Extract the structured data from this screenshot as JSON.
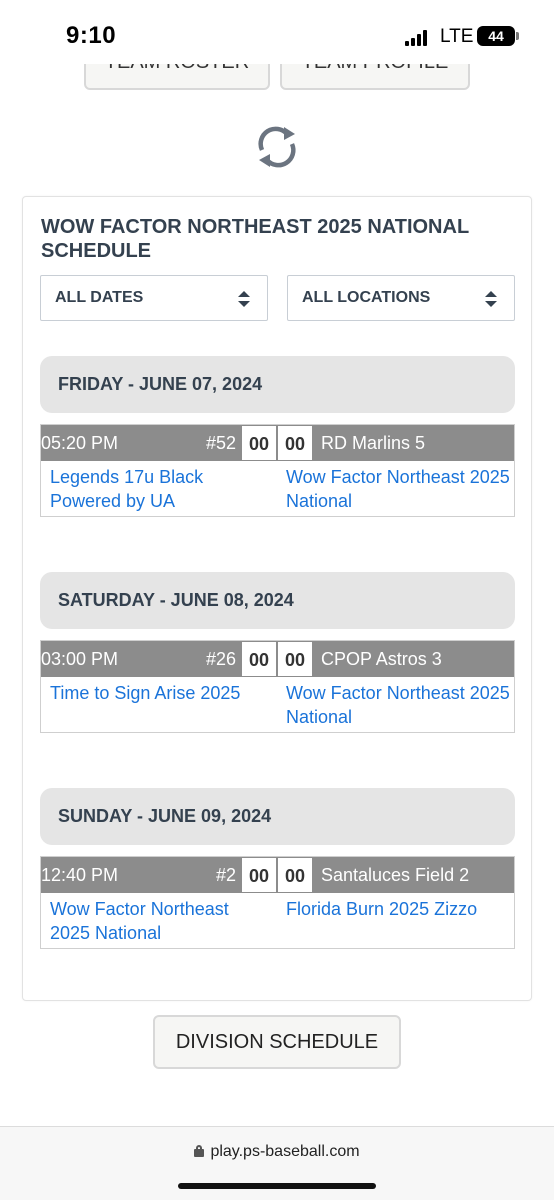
{
  "status": {
    "time": "9:10",
    "network": "LTE",
    "battery": "44"
  },
  "nav": {
    "roster_label": "TEAM ROSTER",
    "profile_label": "TEAM PROFILE"
  },
  "schedule": {
    "title": "WOW FACTOR NORTHEAST 2025 NATIONAL SCHEDULE",
    "date_filter": "ALL DATES",
    "location_filter": "ALL LOCATIONS",
    "days": [
      {
        "header": "FRIDAY - JUNE 07, 2024",
        "game": {
          "time": "05:20 PM",
          "number": "#52",
          "score_home": "00",
          "score_away": "00",
          "location": "RD Marlins 5",
          "home": "Legends 17u Black Powered by UA",
          "away": "Wow Factor Northeast 2025 National"
        }
      },
      {
        "header": "SATURDAY - JUNE 08, 2024",
        "game": {
          "time": "03:00 PM",
          "number": "#26",
          "score_home": "00",
          "score_away": "00",
          "location": "CPOP Astros 3",
          "home": "Time to Sign Arise 2025",
          "away": "Wow Factor Northeast 2025 National"
        }
      },
      {
        "header": "SUNDAY - JUNE 09, 2024",
        "game": {
          "time": "12:40 PM",
          "number": "#2",
          "score_home": "00",
          "score_away": "00",
          "location": "Santaluces Field 2",
          "home": "Wow Factor Northeast 2025 National",
          "away": "Florida Burn 2025 Zizzo"
        }
      }
    ]
  },
  "division_button": "DIVISION SCHEDULE",
  "browser": {
    "url": "play.ps-baseball.com"
  },
  "colors": {
    "link": "#1a73d9",
    "heading": "#34414f",
    "game_bar": "#8c8c8c",
    "day_header": "#e5e5e5"
  }
}
